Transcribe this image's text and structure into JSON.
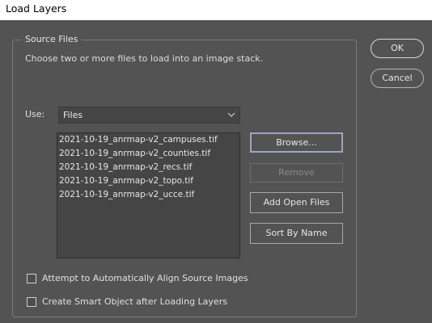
{
  "window": {
    "title": "Load Layers"
  },
  "source_files": {
    "group_label": "Source Files",
    "instructions": "Choose two or more files to load into an image stack.",
    "use_label": "Use:",
    "use_value": "Files",
    "files": [
      "2021-10-19_anrmap-v2_campuses.tif",
      "2021-10-19_anrmap-v2_counties.tif",
      "2021-10-19_anrmap-v2_recs.tif",
      "2021-10-19_anrmap-v2_topo.tif",
      "2021-10-19_anrmap-v2_ucce.tif"
    ],
    "browse_label": "Browse...",
    "remove_label": "Remove",
    "add_open_files_label": "Add Open Files",
    "sort_by_name_label": "Sort By Name",
    "align_label": "Attempt to Automatically Align Source Images",
    "align_checked": false,
    "smart_object_label": "Create Smart Object after Loading Layers",
    "smart_object_checked": false
  },
  "dialog_buttons": {
    "ok_label": "OK",
    "cancel_label": "Cancel"
  },
  "icons": {
    "dropdown": "chevron-down-icon"
  }
}
